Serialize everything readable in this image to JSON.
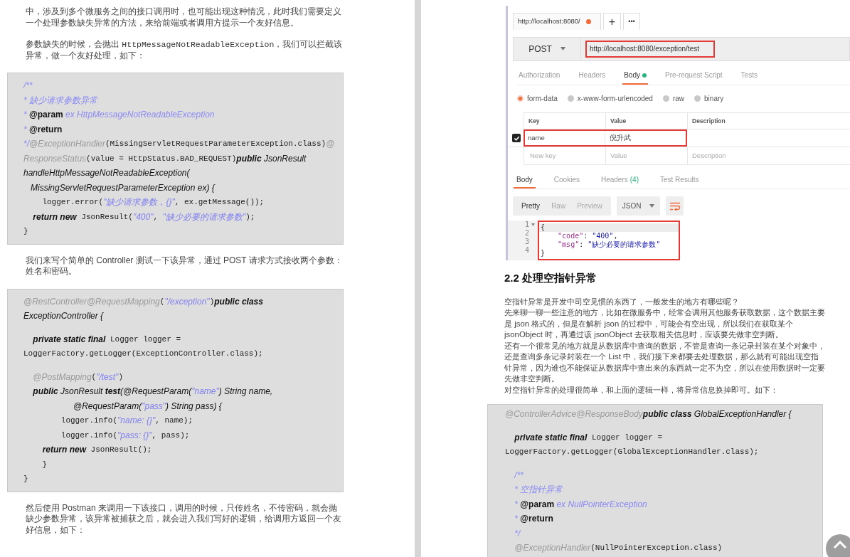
{
  "left_page": {
    "blocks": [
      {
        "kind": "para",
        "parts": [
          {
            "kind": "text",
            "text": "中，涉及到多个微服务之间的接口调用时，也可能出现这种情况，此时我们需要定义一个处理参数缺失异常的方法，来给前端或者调用方提示一个友好信息。"
          }
        ]
      },
      {
        "kind": "para",
        "parts": [
          {
            "kind": "text",
            "text": "参数缺失的时候，会抛出 "
          },
          {
            "kind": "code",
            "text": "HttpMessageNotReadableException"
          },
          {
            "kind": "text",
            "text": "，我们可以拦截该异常，做一个友好处理，如下："
          }
        ]
      },
      {
        "kind": "code",
        "lines": [
          {
            "kind": "code",
            "segments": [
              {
                "kind": "doc",
                "text": "/**"
              }
            ]
          },
          {
            "kind": "code",
            "segments": [
              {
                "kind": "doc",
                "text": "* 缺少请求参数异常"
              }
            ]
          },
          {
            "kind": "code",
            "segments": [
              {
                "kind": "doc",
                "text": "* "
              },
              {
                "kind": "tag",
                "text": "@param"
              },
              {
                "kind": "doc",
                "text": " ex HttpMessageNotReadableException"
              }
            ]
          },
          {
            "kind": "code",
            "segments": [
              {
                "kind": "doc",
                "text": "* "
              },
              {
                "kind": "tag",
                "text": "@return"
              }
            ]
          },
          {
            "kind": "code",
            "segments": [
              {
                "kind": "doc",
                "text": "*/"
              },
              {
                "kind": "anno",
                "text": "@ExceptionHandler"
              },
              {
                "kind": "mono",
                "text": "(MissingServletRequestParameterException.class)"
              },
              {
                "kind": "anno",
                "text": "@"
              }
            ]
          },
          {
            "kind": "code",
            "segments": [
              {
                "kind": "anno",
                "text": "ResponseStatus"
              },
              {
                "kind": "mono",
                "text": "(value = HttpStatus.BAD_REQUEST)"
              },
              {
                "kind": "kw",
                "text": "public"
              },
              {
                "kind": "ital",
                "text": " JsonResult"
              }
            ]
          },
          {
            "kind": "code",
            "segments": [
              {
                "kind": "ital",
                "text": "handleHttpMessageNotReadableException("
              }
            ]
          },
          {
            "kind": "code",
            "segments": [
              {
                "kind": "ital",
                "text": "   MissingServletRequestParameterException ex) {"
              }
            ]
          },
          {
            "kind": "code",
            "segments": [
              {
                "kind": "mono",
                "text": "    logger.error("
              },
              {
                "kind": "str",
                "text": "\"缺少请求参数，{}\""
              },
              {
                "kind": "mono",
                "text": ", ex.getMessage());"
              }
            ]
          },
          {
            "kind": "code",
            "segments": [
              {
                "kind": "kw",
                "text": "    return new"
              },
              {
                "kind": "mono",
                "text": " JsonResult("
              },
              {
                "kind": "str",
                "text": "\"400\""
              },
              {
                "kind": "mono",
                "text": ", "
              },
              {
                "kind": "str",
                "text": "\"缺少必要的请求参数\""
              },
              {
                "kind": "mono",
                "text": ");"
              }
            ]
          },
          {
            "kind": "code",
            "segments": [
              {
                "kind": "mono",
                "text": "}"
              }
            ]
          }
        ]
      },
      {
        "kind": "para",
        "parts": [
          {
            "kind": "text",
            "text": "我们来写个简单的 Controller 测试一下该异常，通过 POST 请求方式接收两个参数：姓名和密码。"
          }
        ]
      },
      {
        "kind": "code",
        "lines": [
          {
            "kind": "code",
            "segments": [
              {
                "kind": "anno",
                "text": "@RestController@RequestMapping"
              },
              {
                "kind": "mono",
                "text": "("
              },
              {
                "kind": "str",
                "text": "\"/exception\""
              },
              {
                "kind": "mono",
                "text": ")"
              },
              {
                "kind": "kw",
                "text": "public class"
              }
            ]
          },
          {
            "kind": "code",
            "segments": [
              {
                "kind": "ital",
                "text": "ExceptionController {"
              }
            ]
          },
          {
            "kind": "blank"
          },
          {
            "kind": "code",
            "segments": [
              {
                "kind": "kw",
                "text": "    private static final"
              },
              {
                "kind": "mono",
                "text": " Logger logger ="
              }
            ]
          },
          {
            "kind": "code",
            "segments": [
              {
                "kind": "mono",
                "text": "LoggerFactory.getLogger(ExceptionController.class);"
              }
            ]
          },
          {
            "kind": "blank"
          },
          {
            "kind": "code",
            "segments": [
              {
                "kind": "anno",
                "text": "    @PostMapping"
              },
              {
                "kind": "mono",
                "text": "("
              },
              {
                "kind": "str",
                "text": "\"/test\""
              },
              {
                "kind": "mono",
                "text": ")"
              }
            ]
          },
          {
            "kind": "code",
            "segments": [
              {
                "kind": "kw",
                "text": "    public"
              },
              {
                "kind": "ital",
                "text": " JsonResult "
              },
              {
                "kind": "kw",
                "text": "test"
              },
              {
                "kind": "ital",
                "text": "(@RequestParam("
              },
              {
                "kind": "str",
                "text": "\"name\""
              },
              {
                "kind": "ital",
                "text": ") String name,"
              }
            ]
          },
          {
            "kind": "code",
            "segments": [
              {
                "kind": "ital",
                "text": "                     @RequestParam("
              },
              {
                "kind": "str",
                "text": "\"pass\""
              },
              {
                "kind": "ital",
                "text": ") String pass) {"
              }
            ]
          },
          {
            "kind": "code",
            "segments": [
              {
                "kind": "mono",
                "text": "        logger.info("
              },
              {
                "kind": "str",
                "text": "\"name: {}\""
              },
              {
                "kind": "mono",
                "text": ", name);"
              }
            ]
          },
          {
            "kind": "code",
            "segments": [
              {
                "kind": "mono",
                "text": "        logger.info("
              },
              {
                "kind": "str",
                "text": "\"pass: {}\""
              },
              {
                "kind": "mono",
                "text": ", pass);"
              }
            ]
          },
          {
            "kind": "code",
            "segments": [
              {
                "kind": "kw",
                "text": "        return new"
              },
              {
                "kind": "mono",
                "text": " JsonResult();"
              }
            ]
          },
          {
            "kind": "code",
            "segments": [
              {
                "kind": "mono",
                "text": "    }"
              }
            ]
          },
          {
            "kind": "code",
            "segments": [
              {
                "kind": "mono",
                "text": "}"
              }
            ]
          }
        ]
      },
      {
        "kind": "para",
        "parts": [
          {
            "kind": "text",
            "text": "然后使用 Postman 来调用一下该接口，调用的时候，只传姓名，不传密码，就会抛缺少参数异常，该异常被捕获之后，就会进入我们写好的逻辑，给调用方返回一个友好信息，如下："
          }
        ]
      }
    ]
  },
  "right_page": {
    "postman": {
      "tabs": [
        {
          "label": "http://localhost:8080/",
          "unsaved": true
        }
      ],
      "new_tab": "+",
      "more": "•••",
      "method": "POST",
      "url": "http://localhost:8080/exception/test",
      "url_annotated": true,
      "request_tabs": [
        {
          "label": "Authorization",
          "selected": false,
          "indicator": false
        },
        {
          "label": "Headers",
          "selected": false,
          "indicator": false
        },
        {
          "label": "Body",
          "selected": true,
          "indicator": true
        },
        {
          "label": "Pre-request Script",
          "selected": false,
          "indicator": false
        },
        {
          "label": "Tests",
          "selected": false,
          "indicator": false
        }
      ],
      "body_types": [
        {
          "label": "form-data",
          "selected": true
        },
        {
          "label": "x-www-form-urlencoded",
          "selected": false
        },
        {
          "label": "raw",
          "selected": false
        },
        {
          "label": "binary",
          "selected": false
        }
      ],
      "columns": [
        "Key",
        "Value",
        "Description"
      ],
      "rows": [
        {
          "checked": true,
          "key": "name",
          "value": "倪升武",
          "annotated": true
        }
      ],
      "new_row": {
        "key_placeholder": "New key",
        "value_placeholder": "Value",
        "description_placeholder": "Description"
      },
      "response_tabs": [
        {
          "label": "Body",
          "selected": true
        },
        {
          "label": "Cookies",
          "selected": false
        },
        {
          "label": "Headers",
          "count": "(4)",
          "selected": false
        },
        {
          "label": "Test Results",
          "selected": false
        }
      ],
      "view_modes": [
        {
          "label": "Pretty",
          "selected": true
        },
        {
          "label": "Raw",
          "selected": false
        },
        {
          "label": "Preview",
          "selected": false
        }
      ],
      "format": "JSON",
      "response_annotated": true,
      "response_lines": [
        {
          "number": "1",
          "current": true,
          "segments": [
            {
              "kind": "punct",
              "text": "{"
            }
          ]
        },
        {
          "number": "2",
          "current": false,
          "segments": [
            {
              "kind": "key",
              "text": "    \"code\""
            },
            {
              "kind": "punct",
              "text": ": "
            },
            {
              "kind": "string",
              "text": "\"400\""
            },
            {
              "kind": "punct",
              "text": ","
            }
          ]
        },
        {
          "number": "3",
          "current": false,
          "segments": [
            {
              "kind": "key",
              "text": "    \"msg\""
            },
            {
              "kind": "punct",
              "text": ": "
            },
            {
              "kind": "string",
              "text": "\"缺少必要的请求参数\""
            }
          ]
        },
        {
          "number": "4",
          "current": false,
          "segments": [
            {
              "kind": "punct",
              "text": "}"
            }
          ]
        }
      ]
    },
    "heading": "2.2 处理空指针异常",
    "paragraphs": [
      "空指针异常是开发中司空见惯的东西了，一般发生的地方有哪些呢？",
      "先来聊一聊一些注意的地方，比如在微服务中，经常会调用其他服务获取数据，这个数据主要是 json 格式的，但是在解析 json 的过程中，可能会有空出现，所以我们在获取某个 jsonObject 时，再通过该 jsonObject 去获取相关信息时，应该要先做非空判断。",
      "还有一个很常见的地方就是从数据库中查询的数据，不管是查询一条记录封装在某个对象中，还是查询多条记录封装在一个 List 中，我们接下来都要去处理数据，那么就有可能出现空指针异常，因为谁也不能保证从数据库中查出来的东西就一定不为空，所以在使用数据时一定要先做非空判断。",
      "对空指针异常的处理很简单，和上面的逻辑一样，将异常信息换掉即可。如下："
    ],
    "code": [
      {
        "kind": "code",
        "segments": [
          {
            "kind": "anno",
            "text": "@ControllerAdvice@ResponseBody"
          },
          {
            "kind": "kw",
            "text": "public class"
          },
          {
            "kind": "ital",
            "text": " GlobalExceptionHandler {"
          }
        ]
      },
      {
        "kind": "blank"
      },
      {
        "kind": "code",
        "segments": [
          {
            "kind": "kw",
            "text": "    private static final"
          },
          {
            "kind": "mono",
            "text": " Logger logger ="
          }
        ]
      },
      {
        "kind": "code",
        "segments": [
          {
            "kind": "mono",
            "text": "LoggerFactory.getLogger(GlobalExceptionHandler.class);"
          }
        ]
      },
      {
        "kind": "blank"
      },
      {
        "kind": "code",
        "segments": [
          {
            "kind": "doc",
            "text": "    /**"
          }
        ]
      },
      {
        "kind": "code",
        "segments": [
          {
            "kind": "doc",
            "text": "    * 空指针异常"
          }
        ]
      },
      {
        "kind": "code",
        "segments": [
          {
            "kind": "doc",
            "text": "    * "
          },
          {
            "kind": "tag",
            "text": "@param"
          },
          {
            "kind": "doc",
            "text": " ex NullPointerException"
          }
        ]
      },
      {
        "kind": "code",
        "segments": [
          {
            "kind": "doc",
            "text": "    * "
          },
          {
            "kind": "tag",
            "text": "@return"
          }
        ]
      },
      {
        "kind": "code",
        "segments": [
          {
            "kind": "doc",
            "text": "    */"
          }
        ]
      },
      {
        "kind": "code",
        "segments": [
          {
            "kind": "anno",
            "text": "    @ExceptionHandler"
          },
          {
            "kind": "mono",
            "text": "(NullPointerException.class)"
          }
        ]
      }
    ]
  }
}
